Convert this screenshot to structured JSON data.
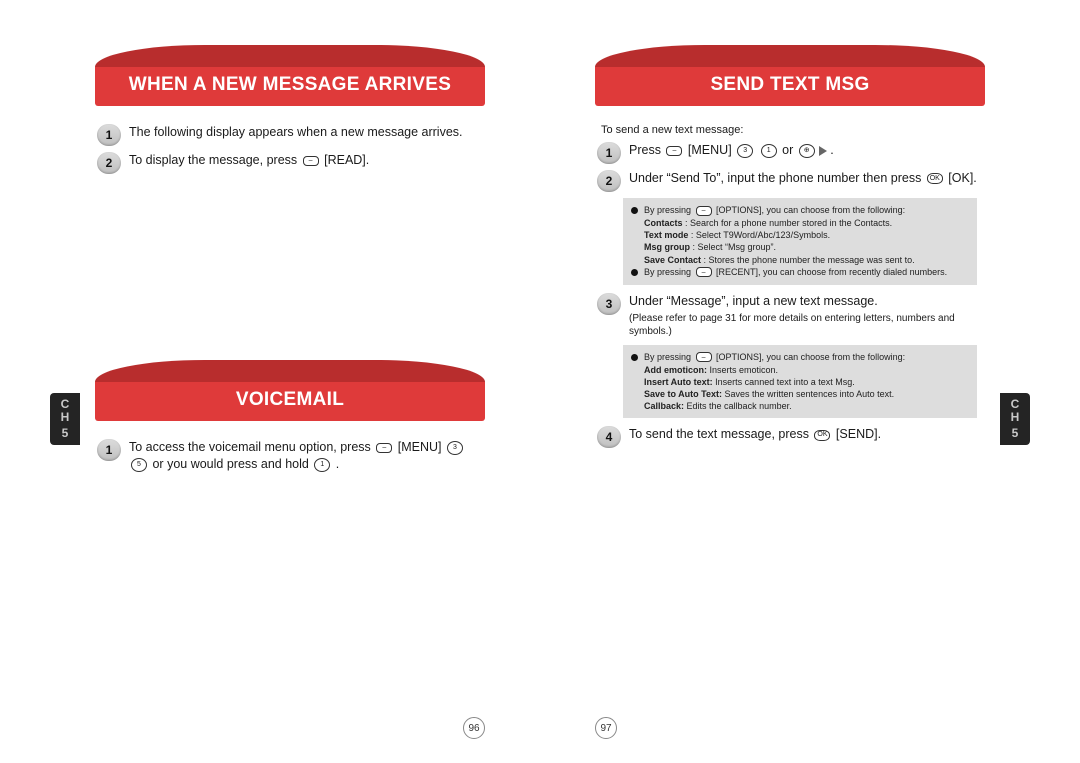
{
  "left_page": {
    "chapter_label": "C\nH",
    "chapter_num": "5",
    "page_number": "96",
    "section1": {
      "title": "WHEN A NEW MESSAGE ARRIVES",
      "step1": "The following display appears when a new message arrives.",
      "step2_a": "To display the message, press ",
      "step2_key": "",
      "step2_b": " [READ]."
    },
    "section2": {
      "title": "VOICEMAIL",
      "step1_a": "To access the voicemail menu option, press ",
      "step1_menu": " [MENU] ",
      "step1_b": " or you would press and hold ",
      "step1_c": " ."
    }
  },
  "right_page": {
    "chapter_label": "C\nH",
    "chapter_num": "5",
    "page_number": "97",
    "title": "SEND TEXT MSG",
    "intro": "To send a new text message:",
    "step1_a": "Press ",
    "step1_b": " [MENU] ",
    "step1_c": " or ",
    "step1_d": " .",
    "step2_a": "Under “Send To”, input the phone number then press ",
    "step2_b": " [OK].",
    "box1": {
      "l1a": "By pressing ",
      "l1b": " [OPTIONS], you can choose from the following:",
      "c_label": "Contacts",
      "c_text": " : Search for a phone number stored in the Contacts.",
      "t_label": "Text mode",
      "t_text": " : Select T9Word/Abc/123/Symbols.",
      "m_label": "Msg group",
      "m_text": " : Select “Msg group”.",
      "s_label": "Save Contact",
      "s_text": " : Stores the phone number the message was sent to.",
      "l2a": "By pressing ",
      "l2b": " [RECENT], you can choose from recently dialed numbers."
    },
    "step3_a": "Under “Message”, input a new text message.",
    "step3_sub": "(Please refer to page 31 for more details on entering letters, numbers and symbols.)",
    "box2": {
      "l1a": "By pressing ",
      "l1b": " [OPTIONS], you can choose from the following:",
      "a_label": "Add emoticon:",
      "a_text": " Inserts emoticon.",
      "i_label": "Insert Auto text:",
      "i_text": " Inserts canned text into a text Msg.",
      "s_label": "Save to Auto Text:",
      "s_text": " Saves the written sentences into Auto text.",
      "c_label": "Callback:",
      "c_text": " Edits the callback number."
    },
    "step4_a": "To send the text message, press ",
    "step4_b": " [SEND]."
  },
  "badges": {
    "one": "1",
    "two": "2",
    "three": "3",
    "four": "4"
  },
  "keys": {
    "soft": "–",
    "menu": "–",
    "ok": "OK",
    "n3": "3",
    "n5": "5",
    "n1": "1"
  }
}
